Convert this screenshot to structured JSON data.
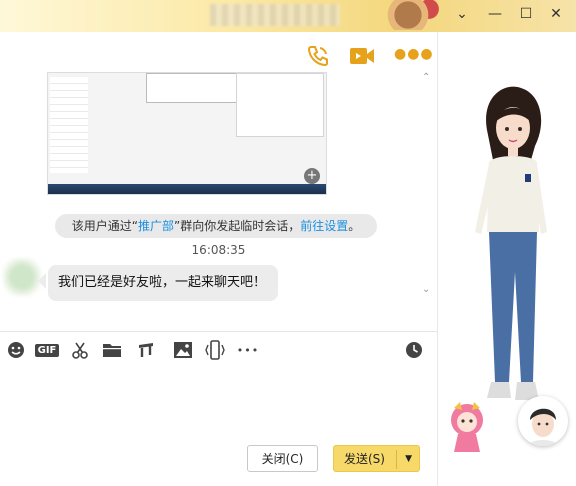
{
  "window": {
    "minimize_label": "⌄",
    "restore_label": "—",
    "maximize_label": "☐",
    "close_label": "✕"
  },
  "header": {
    "icons": [
      "phone-icon",
      "video-call-icon",
      "more-icon"
    ]
  },
  "chat": {
    "notice_prefix": "该用户通过“",
    "notice_group": "推广部",
    "notice_middle": "”群向你发起临时会话，",
    "notice_link": "前往设置",
    "notice_suffix": "。",
    "timestamp": "16:08:35",
    "message": "我们已经是好友啦，一起来聊天吧！"
  },
  "input_toolbar": {
    "icons": [
      "emoji-icon",
      "gif-icon",
      "scissors-icon",
      "folder-icon",
      "music-icon",
      "image-icon",
      "shake-icon",
      "more-icon",
      "history-clock-icon"
    ],
    "gif_label": "GIF",
    "more_label": "•••"
  },
  "actions": {
    "close_label": "关闭(C)",
    "send_label": "发送(S)",
    "send_arrow": "▼"
  },
  "colors": {
    "accent_yellow": "#f7d96a",
    "link_blue": "#1a8fe0",
    "icon_orange": "#e6a21a"
  }
}
